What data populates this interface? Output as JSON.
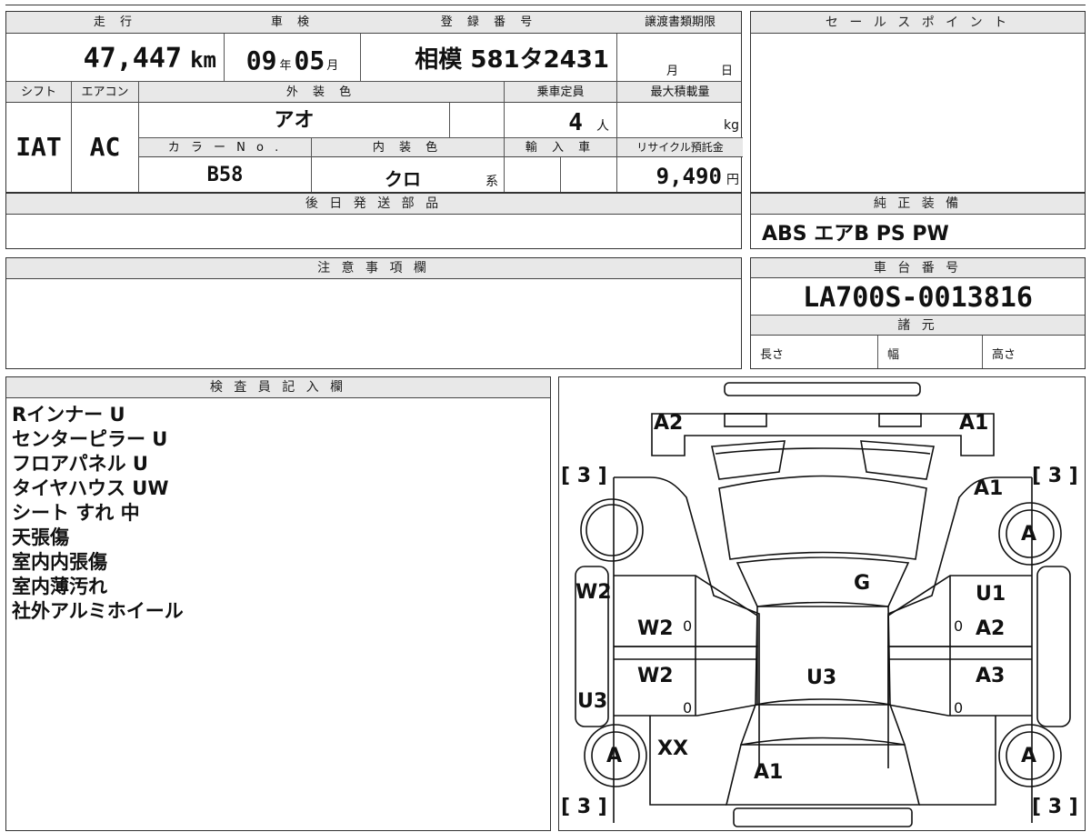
{
  "header": {
    "mileage_label": "走 行",
    "mileage_value": "47,447",
    "mileage_unit": "km",
    "shaken_label": "車 検",
    "shaken_year": "09",
    "shaken_year_unit": "年",
    "shaken_month": "05",
    "shaken_month_unit": "月",
    "registration_label": "登 録 番 号",
    "registration_value": "相模 581タ2431",
    "transfer_label": "譲渡書類期限",
    "transfer_month_unit": "月",
    "transfer_day_unit": "日",
    "sales_point_label": "セ ー ル ス ポ イ ン ト"
  },
  "spec": {
    "shift_label": "シフト",
    "shift_value": "IAT",
    "ac_label": "エアコン",
    "ac_value": "AC",
    "exterior_color_label": "外 装 色",
    "exterior_color_value": "アオ",
    "capacity_label": "乗車定員",
    "capacity_value": "4",
    "capacity_unit": "人",
    "max_load_label": "最大積載量",
    "max_load_unit": "kg",
    "color_no_label": "カ ラ ー N o .",
    "color_no_value": "B58",
    "interior_color_label": "内 装 色",
    "interior_color_value": "クロ",
    "interior_color_unit": "系",
    "import_label": "輸 入 車",
    "recycle_label": "リサイクル預託金",
    "recycle_value": "9,490",
    "recycle_unit": "円"
  },
  "later_parts_label": "後 日 発 送 部 品",
  "equipment_label": "純 正 装 備",
  "equipment_value": "ABS エアB PS PW",
  "notes_label": "注 意 事 項 欄",
  "chassis_label": "車 台 番 号",
  "chassis_value": "LA700S-0013816",
  "dimensions_label": "諸 元",
  "length_label": "長さ",
  "width_label": "幅",
  "height_label": "高さ",
  "inspector_label": "検 査 員 記 入 欄",
  "inspector_notes": [
    "Rインナー U",
    "センターピラー U",
    "フロアパネル U",
    "タイヤハウス UW",
    "シート すれ 中",
    "天張傷",
    "室内内張傷",
    "室内薄汚れ",
    "社外アルミホイール"
  ],
  "diagram": {
    "front_left": "A2",
    "front_right": "A1",
    "bracket_tl": "[ 3 ]",
    "bracket_tr": "[ 3 ]",
    "bracket_bl": "[ 3 ]",
    "bracket_br": "[ 3 ]",
    "fender_right": "A1",
    "wheel_fr": "A",
    "wheel_rl": "A",
    "wheel_rr": "A",
    "side_left_top": "W2",
    "side_left_bottom": "U3",
    "windshield": "G",
    "door_fl": "W2",
    "door_rl": "W2",
    "door_fr_1": "U1",
    "door_fr_2": "A2",
    "door_rr": "A3",
    "roof": "U3",
    "rear_left": "XX",
    "rear": "A1",
    "zero_marks": [
      "0",
      "0",
      "0",
      "0"
    ]
  }
}
